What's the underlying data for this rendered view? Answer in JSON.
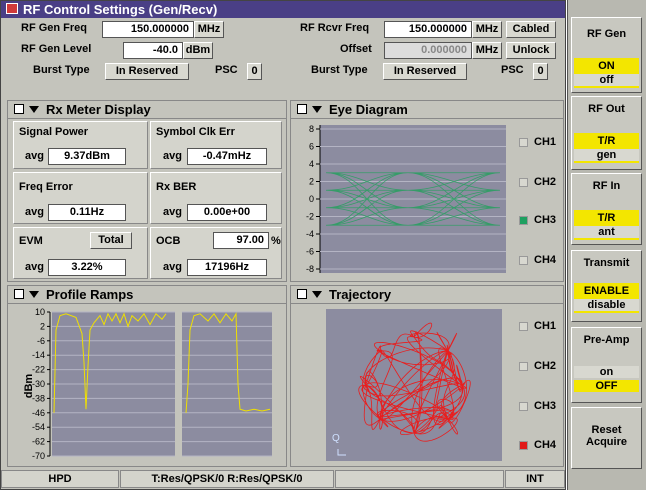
{
  "title": "RF Control Settings (Gen/Recv)",
  "gen": {
    "freq_label": "RF Gen Freq",
    "freq_value": "150.000000",
    "freq_unit": "MHz",
    "level_label": "RF Gen Level",
    "level_value": "-40.0",
    "level_unit": "dBm",
    "burst_label": "Burst Type",
    "burst_value": "In Reserved",
    "psc_label": "PSC",
    "psc_value": "0"
  },
  "rcvr": {
    "freq_label": "RF Rcvr Freq",
    "freq_value": "150.000000",
    "freq_unit": "MHz",
    "cabled": "Cabled",
    "offset_label": "Offset",
    "offset_value": "0.000000",
    "offset_unit": "MHz",
    "unlock": "Unlock",
    "burst_label": "Burst Type",
    "burst_value": "In Reserved",
    "psc_label": "PSC",
    "psc_value": "0"
  },
  "rx_meter": {
    "title": "Rx Meter Display",
    "signal_power_label": "Signal Power",
    "signal_power_avg": "avg",
    "signal_power_value": "9.37dBm",
    "symbol_clk_label": "Symbol Clk Err",
    "symbol_clk_avg": "avg",
    "symbol_clk_value": "-0.47mHz",
    "freq_error_label": "Freq Error",
    "freq_error_avg": "avg",
    "freq_error_value": "0.11Hz",
    "rx_ber_label": "Rx BER",
    "rx_ber_avg": "avg",
    "rx_ber_value": "0.00e+00",
    "evm_label": "EVM",
    "evm_button": "Total",
    "evm_avg": "avg",
    "evm_value": "3.22%",
    "ocb_label": "OCB",
    "ocb_input": "97.00",
    "ocb_unit": "%",
    "ocb_avg": "avg",
    "ocb_value": "17196Hz"
  },
  "eye": {
    "title": "Eye Diagram",
    "yticks": [
      "8",
      "6",
      "4",
      "2",
      "0",
      "-2",
      "-4",
      "-6",
      "-8"
    ],
    "channels": [
      "CH1",
      "CH2",
      "CH3",
      "CH4"
    ],
    "selected_channel": "CH3",
    "trace_color": "#1fa05a"
  },
  "profile": {
    "title": "Profile Ramps",
    "ylabel": "dBm",
    "yticks": [
      "10",
      "2",
      "-6",
      "-14",
      "-22",
      "-30",
      "-38",
      "-46",
      "-54",
      "-62",
      "-70"
    ],
    "trace_color": "#f0e000"
  },
  "trajectory": {
    "title": "Trajectory",
    "channels": [
      "CH1",
      "CH2",
      "CH3",
      "CH4"
    ],
    "selected_channel": "CH4",
    "trace_color": "#e81e1e"
  },
  "softkeys": {
    "rf_gen": {
      "label": "RF Gen",
      "on": "ON",
      "off": "off"
    },
    "rf_out": {
      "label": "RF Out",
      "top": "T/R",
      "bottom": "gen"
    },
    "rf_in": {
      "label": "RF In",
      "top": "T/R",
      "bottom": "ant"
    },
    "transmit": {
      "label": "Transmit",
      "top": "ENABLE",
      "bottom": "disable"
    },
    "preamp": {
      "label": "Pre-Amp",
      "top": "on",
      "bottom": "OFF"
    },
    "reset": {
      "line1": "Reset",
      "line2": "Acquire"
    }
  },
  "status": {
    "left": "HPD",
    "middle": "T:Res/QPSK/0 R:Res/QPSK/0",
    "right": "INT"
  }
}
